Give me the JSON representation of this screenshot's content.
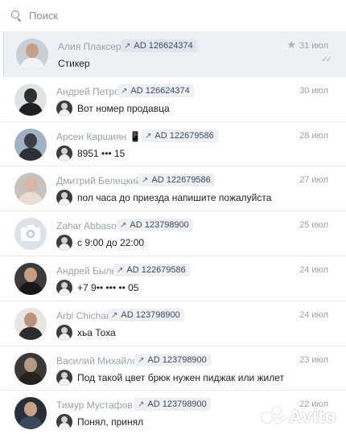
{
  "search": {
    "placeholder": "Поиск"
  },
  "conversations": [
    {
      "name": "Алия Плаксер 🖕",
      "ad": "AD 126624374",
      "date": "31 июл",
      "preview": "Стикер",
      "has_star": true,
      "read_status": "✓✓",
      "avatar_colors": {
        "bg": "#c9cfd6",
        "head": "#c79f86",
        "body": "#f3f3f3"
      }
    },
    {
      "name": "Андрей Петров",
      "ad": "AD 126624374",
      "date": "30 июл",
      "preview": "Вот номер продавца",
      "avatar_colors": {
        "bg": "#dfe3e6",
        "head": "#2f2f2f",
        "body": "#1f1f22"
      }
    },
    {
      "name": "Арсен Каршиян 📱",
      "ad": "AD 122679586",
      "date": "28 июл",
      "preview": "8951 ••• 15",
      "avatar_colors": {
        "bg": "#9fb1c2",
        "head": "#3a3f46",
        "body": "#2c3137"
      }
    },
    {
      "name": "Дмитрий Белецкий",
      "ad": "AD 122679586",
      "date": "27 июл",
      "preview": "пол часа до приезда напишите пожалуйста",
      "avatar_colors": {
        "bg": "#c8c2bd",
        "head": "#d8b8a4",
        "body": "#ecdcd2"
      }
    },
    {
      "name": "Zahar Abbasov",
      "ad": "AD 123798900",
      "date": "25 июл",
      "preview": "с 9:00 до 22:00",
      "avatar_colors": {
        "bg": "#dde2ea"
      },
      "placeholder_avatar": true
    },
    {
      "name": "Андрей Быльц",
      "ad": "AD 122679586",
      "date": "24 июл",
      "preview": "+7 9•• ••• •• 05",
      "avatar_colors": {
        "bg": "#3b3a3d",
        "head": "#c89c7e",
        "body": "#171719"
      }
    },
    {
      "name": "Arbi Chichani",
      "ad": "AD 123798900",
      "date": "24 июл",
      "preview": "хьа Тоха",
      "avatar_colors": {
        "bg": "#e7e4e1",
        "head": "#b8937a",
        "body": "#2c2c33"
      }
    },
    {
      "name": "Василий Михайлов",
      "ad": "AD 123798900",
      "date": "23 июл",
      "preview": "Под такой цвет брюк нужен пиджак или жилет",
      "avatar_colors": {
        "bg": "#3b3835",
        "head": "#b49a84",
        "body": "#24211f"
      }
    },
    {
      "name": "Тимур Мустафов",
      "ad": "AD 123798900",
      "date": "22 июл",
      "preview": "Понял, принял",
      "avatar_colors": {
        "bg": "#27303a",
        "head": "#c9a285",
        "body": "#3b4a5a"
      }
    }
  ],
  "watermark": {
    "text": "Avito"
  },
  "colors": {
    "accent": "#2a5885",
    "tag_bg": "#eef0f4",
    "selected_bg": "#edf0f5",
    "muted_text": "#9aa1ab"
  }
}
